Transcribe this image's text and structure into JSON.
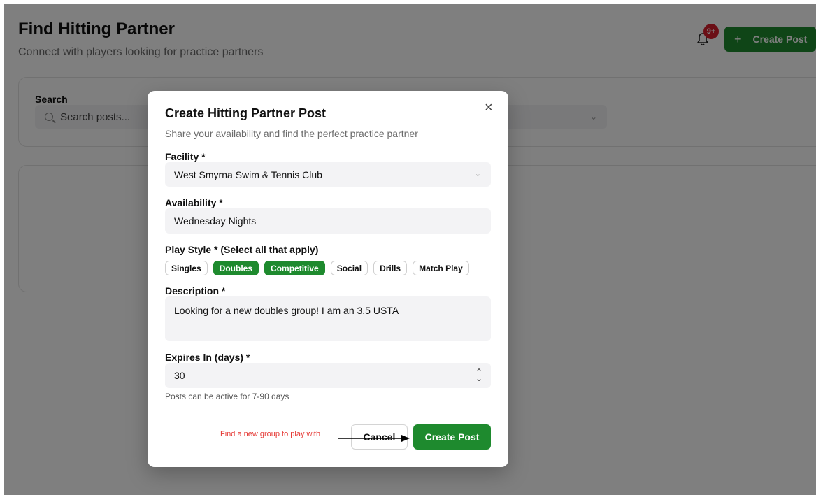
{
  "page": {
    "title": "Find Hitting Partner",
    "subtitle": "Connect with players looking for practice partners",
    "notification_badge": "9+",
    "create_post_label": "Create Post",
    "filters": {
      "search_label": "Search",
      "search_placeholder": "Search posts..."
    }
  },
  "modal": {
    "title": "Create Hitting Partner Post",
    "subtitle": "Share your availability and find the perfect practice partner",
    "facility_label": "Facility *",
    "facility_value": "West Smyrna Swim & Tennis Club",
    "availability_label": "Availability *",
    "availability_value": "Wednesday Nights",
    "play_style_label": "Play Style * (Select all that apply)",
    "play_styles": [
      {
        "label": "Singles",
        "selected": false
      },
      {
        "label": "Doubles",
        "selected": true
      },
      {
        "label": "Competitive",
        "selected": true
      },
      {
        "label": "Social",
        "selected": false
      },
      {
        "label": "Drills",
        "selected": false
      },
      {
        "label": "Match Play",
        "selected": false
      }
    ],
    "description_label": "Description *",
    "description_value": "Looking for a new doubles group! I am an 3.5 USTA",
    "expires_label": "Expires In (days) *",
    "expires_value": "30",
    "expires_hint": "Posts can be active for 7-90 days",
    "cancel_label": "Cancel",
    "submit_label": "Create Post"
  },
  "annotation": {
    "text": "Find a new group to play with"
  },
  "colors": {
    "brand_green": "#1e8a2e",
    "badge_red": "#d61f2c",
    "annotation_red": "#e53935"
  },
  "icons": [
    "bell-icon",
    "plus-icon",
    "search-icon",
    "chevron-down-icon",
    "close-icon",
    "stepper-icon",
    "arrow-icon"
  ]
}
